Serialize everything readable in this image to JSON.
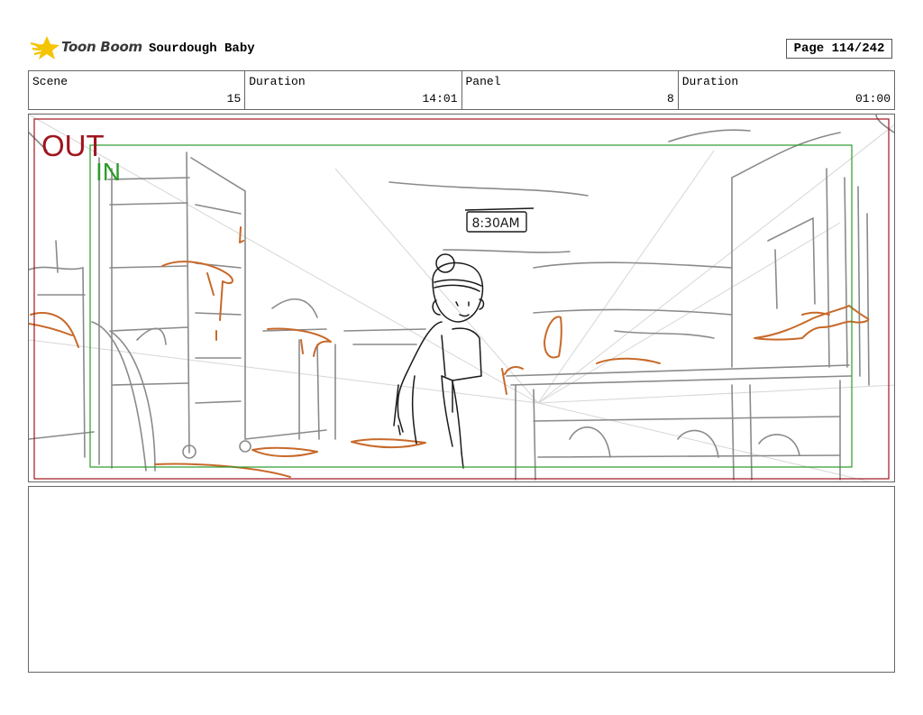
{
  "header": {
    "logo_text": "Toon Boom",
    "project_title": "Sourdough Baby",
    "page_label": "Page 114/242"
  },
  "info": [
    {
      "label": "Scene",
      "value": "15"
    },
    {
      "label": "Duration",
      "value": "14:01"
    },
    {
      "label": "Panel",
      "value": "8"
    },
    {
      "label": "Duration",
      "value": "01:00"
    }
  ],
  "panel": {
    "out_label": "OUT",
    "in_label": "IN",
    "clock_text": "8:30AM",
    "colors": {
      "out": "#a0141e",
      "in": "#2a9a2a",
      "sketch": "#888888",
      "dough": "#c8692a",
      "ink": "#1a1a1a"
    }
  },
  "notes": {
    "text": ""
  }
}
